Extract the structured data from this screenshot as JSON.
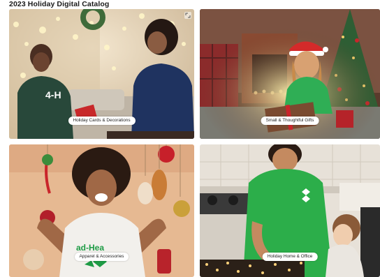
{
  "catalog": {
    "title": "2023 Holiday Digital Catalog"
  },
  "tiles": [
    {
      "label": "Holiday Cards & Decorations",
      "shirt_text": "4-H"
    },
    {
      "label": "Small & Thoughtful Gifts"
    },
    {
      "label": "Apparel & Accessories",
      "shirt_text": "ad-Hea"
    },
    {
      "label": "Holiday Home & Office"
    }
  ],
  "colors": {
    "brand_green": "#1e9b45",
    "navy": "#1c2e57",
    "pill_bg": "#ffffff"
  },
  "icons": {
    "expand": "expand-icon"
  }
}
